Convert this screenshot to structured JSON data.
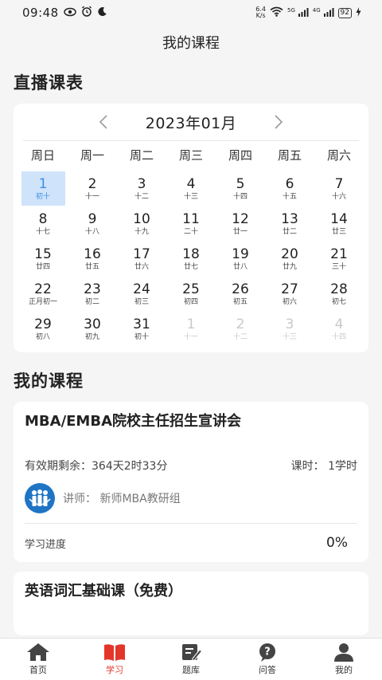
{
  "status_bar": {
    "time": "09:48",
    "net_speed_value": "6.4",
    "net_speed_unit": "K/s",
    "signal1_tag": "5G",
    "signal2_tag": "4G",
    "battery": "92"
  },
  "nav": {
    "title": "我的课程"
  },
  "live_schedule": {
    "section_title": "直播课表",
    "month": "2023年01月",
    "weekdays": [
      "周日",
      "周一",
      "周二",
      "周三",
      "周四",
      "周五",
      "周六"
    ],
    "days": [
      {
        "n": "1",
        "l": "初十",
        "state": "selected"
      },
      {
        "n": "2",
        "l": "十一"
      },
      {
        "n": "3",
        "l": "十二"
      },
      {
        "n": "4",
        "l": "十三"
      },
      {
        "n": "5",
        "l": "十四"
      },
      {
        "n": "6",
        "l": "十五"
      },
      {
        "n": "7",
        "l": "十六"
      },
      {
        "n": "8",
        "l": "十七"
      },
      {
        "n": "9",
        "l": "十八"
      },
      {
        "n": "10",
        "l": "十九"
      },
      {
        "n": "11",
        "l": "二十"
      },
      {
        "n": "12",
        "l": "廿一"
      },
      {
        "n": "13",
        "l": "廿二"
      },
      {
        "n": "14",
        "l": "廿三"
      },
      {
        "n": "15",
        "l": "廿四"
      },
      {
        "n": "16",
        "l": "廿五"
      },
      {
        "n": "17",
        "l": "廿六"
      },
      {
        "n": "18",
        "l": "廿七"
      },
      {
        "n": "19",
        "l": "廿八"
      },
      {
        "n": "20",
        "l": "廿九"
      },
      {
        "n": "21",
        "l": "三十"
      },
      {
        "n": "22",
        "l": "正月初一"
      },
      {
        "n": "23",
        "l": "初二"
      },
      {
        "n": "24",
        "l": "初三"
      },
      {
        "n": "25",
        "l": "初四"
      },
      {
        "n": "26",
        "l": "初五"
      },
      {
        "n": "27",
        "l": "初六"
      },
      {
        "n": "28",
        "l": "初七"
      },
      {
        "n": "29",
        "l": "初八"
      },
      {
        "n": "30",
        "l": "初九"
      },
      {
        "n": "31",
        "l": "初十"
      },
      {
        "n": "1",
        "l": "十一",
        "state": "other"
      },
      {
        "n": "2",
        "l": "十二",
        "state": "other"
      },
      {
        "n": "3",
        "l": "十三",
        "state": "other"
      },
      {
        "n": "4",
        "l": "十四",
        "state": "other"
      }
    ]
  },
  "my_courses": {
    "section_title": "我的课程",
    "items": [
      {
        "title": "MBA/EMBA院校主任招生宣讲会",
        "validity": "有效期剩余：364天2时33分",
        "hours": "课时：  1学时",
        "teacher": "讲师：  新师MBA教研组",
        "progress_label": "学习进度",
        "progress_value": "0%"
      },
      {
        "title": "英语词汇基础课（免费）"
      }
    ]
  },
  "tabs": [
    {
      "label": "首页",
      "icon": "home-icon"
    },
    {
      "label": "学习",
      "icon": "book-icon",
      "active": true
    },
    {
      "label": "题库",
      "icon": "edit-icon"
    },
    {
      "label": "问答",
      "icon": "question-icon"
    },
    {
      "label": "我的",
      "icon": "user-icon"
    }
  ],
  "colors": {
    "accent_red": "#e3352a",
    "selected_bg": "#cfe3fb",
    "selected_text": "#3b8ee8",
    "teacher_logo": "#1f74c4"
  }
}
